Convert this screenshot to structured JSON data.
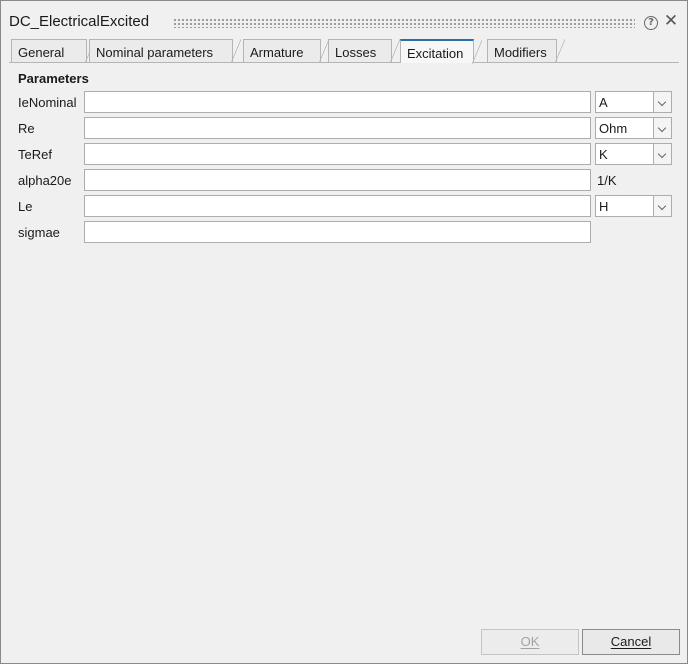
{
  "window": {
    "title": "DC_ElectricalExcited"
  },
  "tabs": [
    {
      "label": "General"
    },
    {
      "label": "Nominal parameters"
    },
    {
      "label": "Armature"
    },
    {
      "label": "Losses"
    },
    {
      "label": "Excitation"
    },
    {
      "label": "Modifiers"
    }
  ],
  "active_tab": "Excitation",
  "section": {
    "title": "Parameters"
  },
  "params": [
    {
      "label": "IeNominal",
      "value": "",
      "unit": "A"
    },
    {
      "label": "Re",
      "value": "",
      "unit": "Ohm"
    },
    {
      "label": "TeRef",
      "value": "",
      "unit": "K"
    },
    {
      "label": "alpha20e",
      "value": "",
      "unit": "1/K"
    },
    {
      "label": "Le",
      "value": "",
      "unit": "H"
    },
    {
      "label": "sigmae",
      "value": ""
    }
  ],
  "buttons": {
    "ok": "OK",
    "cancel": "Cancel"
  }
}
